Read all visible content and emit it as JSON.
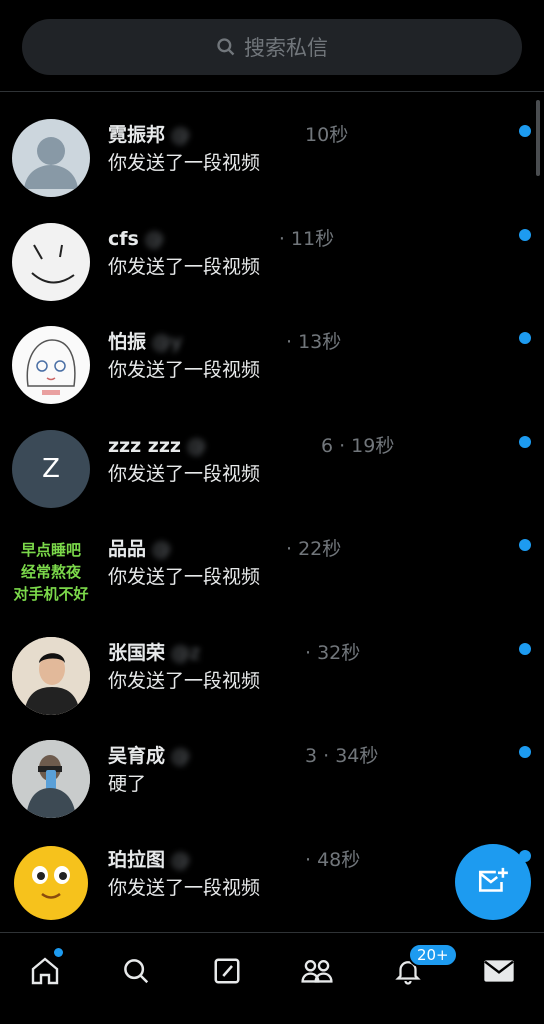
{
  "search": {
    "placeholder": "搜索私信"
  },
  "conversations": [
    {
      "name": "霓振邦",
      "handle": "@",
      "time": "10秒",
      "preview": "你发送了一段视频",
      "unread": true
    },
    {
      "name": "cfs",
      "handle": "@",
      "time": "· 11秒",
      "preview": "你发送了一段视频",
      "unread": true
    },
    {
      "name": "怕振",
      "handle": "@y",
      "time": "· 13秒",
      "preview": "你发送了一段视频",
      "unread": true
    },
    {
      "name": "zzz zzz",
      "handle": "@",
      "time": "6 · 19秒",
      "preview": "你发送了一段视频",
      "unread": true
    },
    {
      "name": "品品",
      "handle": "@",
      "time": "· 22秒",
      "preview": "你发送了一段视频",
      "unread": true
    },
    {
      "name": "张国荣",
      "handle": "@z",
      "time": "· 32秒",
      "preview": "你发送了一段视频",
      "unread": true
    },
    {
      "name": "吴育成",
      "handle": "@",
      "time": "3 · 34秒",
      "preview": "硬了",
      "unread": true
    },
    {
      "name": "珀拉图",
      "handle": "@",
      "time": "· 48秒",
      "preview": "你发送了一段视频",
      "unread": true
    }
  ],
  "avatars": [
    {
      "icon": "default-avatar-icon"
    },
    {
      "icon": "smiley-face-icon"
    },
    {
      "icon": "anime-girl-icon"
    },
    {
      "icon": "letter-avatar",
      "letter": "Z"
    },
    {
      "icon": "green-text-image",
      "text": "早点睡吧\n经常熬夜\n对手机不好"
    },
    {
      "icon": "photo-man-icon"
    },
    {
      "icon": "photo-person-icon"
    },
    {
      "icon": "yellow-emoji-icon"
    }
  ],
  "tabbar": {
    "items": [
      "home-icon",
      "search-icon",
      "compose-icon",
      "communities-icon",
      "notifications-icon",
      "messages-icon"
    ],
    "notifications_badge": "20+"
  },
  "colors": {
    "accent": "#1d9bf0",
    "background": "#000000",
    "secondary_text": "#71767b"
  }
}
